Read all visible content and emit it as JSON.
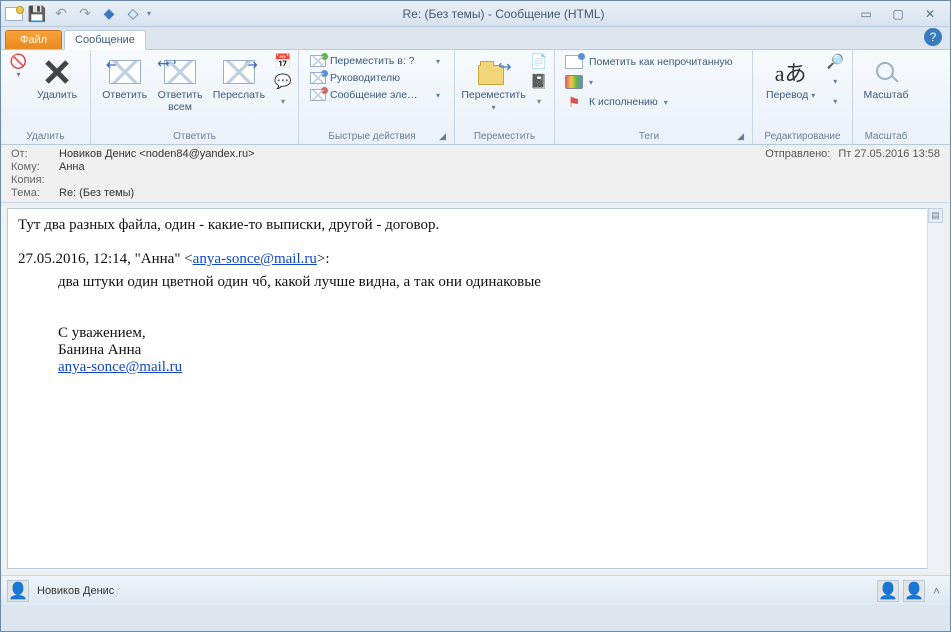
{
  "window": {
    "title": "Re: (Без темы)  -  Сообщение (HTML)"
  },
  "tabs": {
    "file": "Файл",
    "message": "Сообщение"
  },
  "ribbon": {
    "delete_group": "Удалить",
    "delete": "Удалить",
    "respond_group": "Ответить",
    "reply": "Ответить",
    "replyall": "Ответить\nвсем",
    "forward": "Переслать",
    "qa_group": "Быстрые действия",
    "qa_moveq": "Переместить в: ?",
    "qa_mgr": "Руководителю",
    "qa_team": "Сообщение эле…",
    "move_group": "Переместить",
    "move": "Переместить",
    "tags_group": "Теги",
    "mark_unread": "Пометить как непрочитанную",
    "followup": "К исполнению",
    "edit_group": "Редактирование",
    "translate": "Перевод",
    "zoom_group": "Масштаб",
    "zoom": "Масштаб"
  },
  "header": {
    "from_lbl": "От:",
    "from_val": "Новиков Денис <noden84@yandex.ru>",
    "sent_lbl": "Отправлено:",
    "sent_val": "Пт 27.05.2016 13:58",
    "to_lbl": "Кому:",
    "to_val": "Анна",
    "cc_lbl": "Копия:",
    "cc_val": "",
    "subj_lbl": "Тема:",
    "subj_val": "Re: (Без темы)"
  },
  "body": {
    "line1": "Тут два разных файла, один - какие-то выписки, другой - договор.",
    "qhdr_pre": "27.05.2016, 12:14, \"Анна\" <",
    "qhdr_mail": "anya-sonce@mail.ru",
    "qhdr_post": ">:",
    "q1": "два штуки один цветной один чб, какой лучше видна, а так они одинаковые",
    "sig1": "С уважением,",
    "sig2": "Банина Анна",
    "sig_mail": "anya-sonce@mail.ru"
  },
  "status": {
    "name": "Новиков Денис"
  }
}
